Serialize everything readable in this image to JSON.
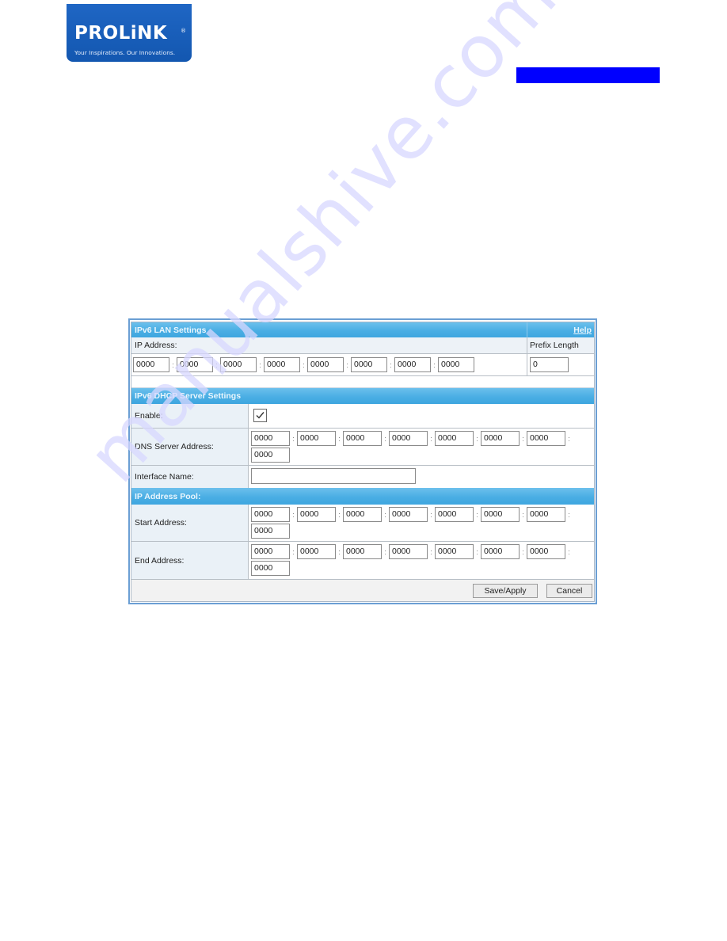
{
  "brand": {
    "logo_text": "PROLiNK",
    "registered": "®",
    "tagline": "Your Inspirations. Our Innovations."
  },
  "watermark": "manualshive.com",
  "colors": {
    "logo_bg": "#1a5fbd",
    "blue_bar": "#0000ff",
    "section_header": "#4aaee4",
    "panel_border": "#6b9fd4"
  },
  "lan": {
    "title": "IPv6 LAN Settings",
    "help_label": "Help",
    "ip_label": "IP Address:",
    "prefix_label": "Prefix Length",
    "ip_segments": [
      "0000",
      "0000",
      "0000",
      "0000",
      "0000",
      "0000",
      "0000",
      "0000"
    ],
    "separator": ":",
    "prefix_value": "0"
  },
  "dhcp": {
    "title": "IPv6 DHCP Server Settings",
    "enable_label": "Enable:",
    "enable_checked": true,
    "dns_label": "DNS Server Address:",
    "dns_segments": [
      "0000",
      "0000",
      "0000",
      "0000",
      "0000",
      "0000",
      "0000",
      "0000"
    ],
    "interface_label": "Interface Name:",
    "interface_value": ""
  },
  "pool": {
    "title": "IP Address Pool:",
    "start_label": "Start Address:",
    "start_segments": [
      "0000",
      "0000",
      "0000",
      "0000",
      "0000",
      "0000",
      "0000",
      "0000"
    ],
    "end_label": "End Address:",
    "end_segments": [
      "0000",
      "0000",
      "0000",
      "0000",
      "0000",
      "0000",
      "0000",
      "0000"
    ]
  },
  "buttons": {
    "save": "Save/Apply",
    "cancel": "Cancel"
  }
}
